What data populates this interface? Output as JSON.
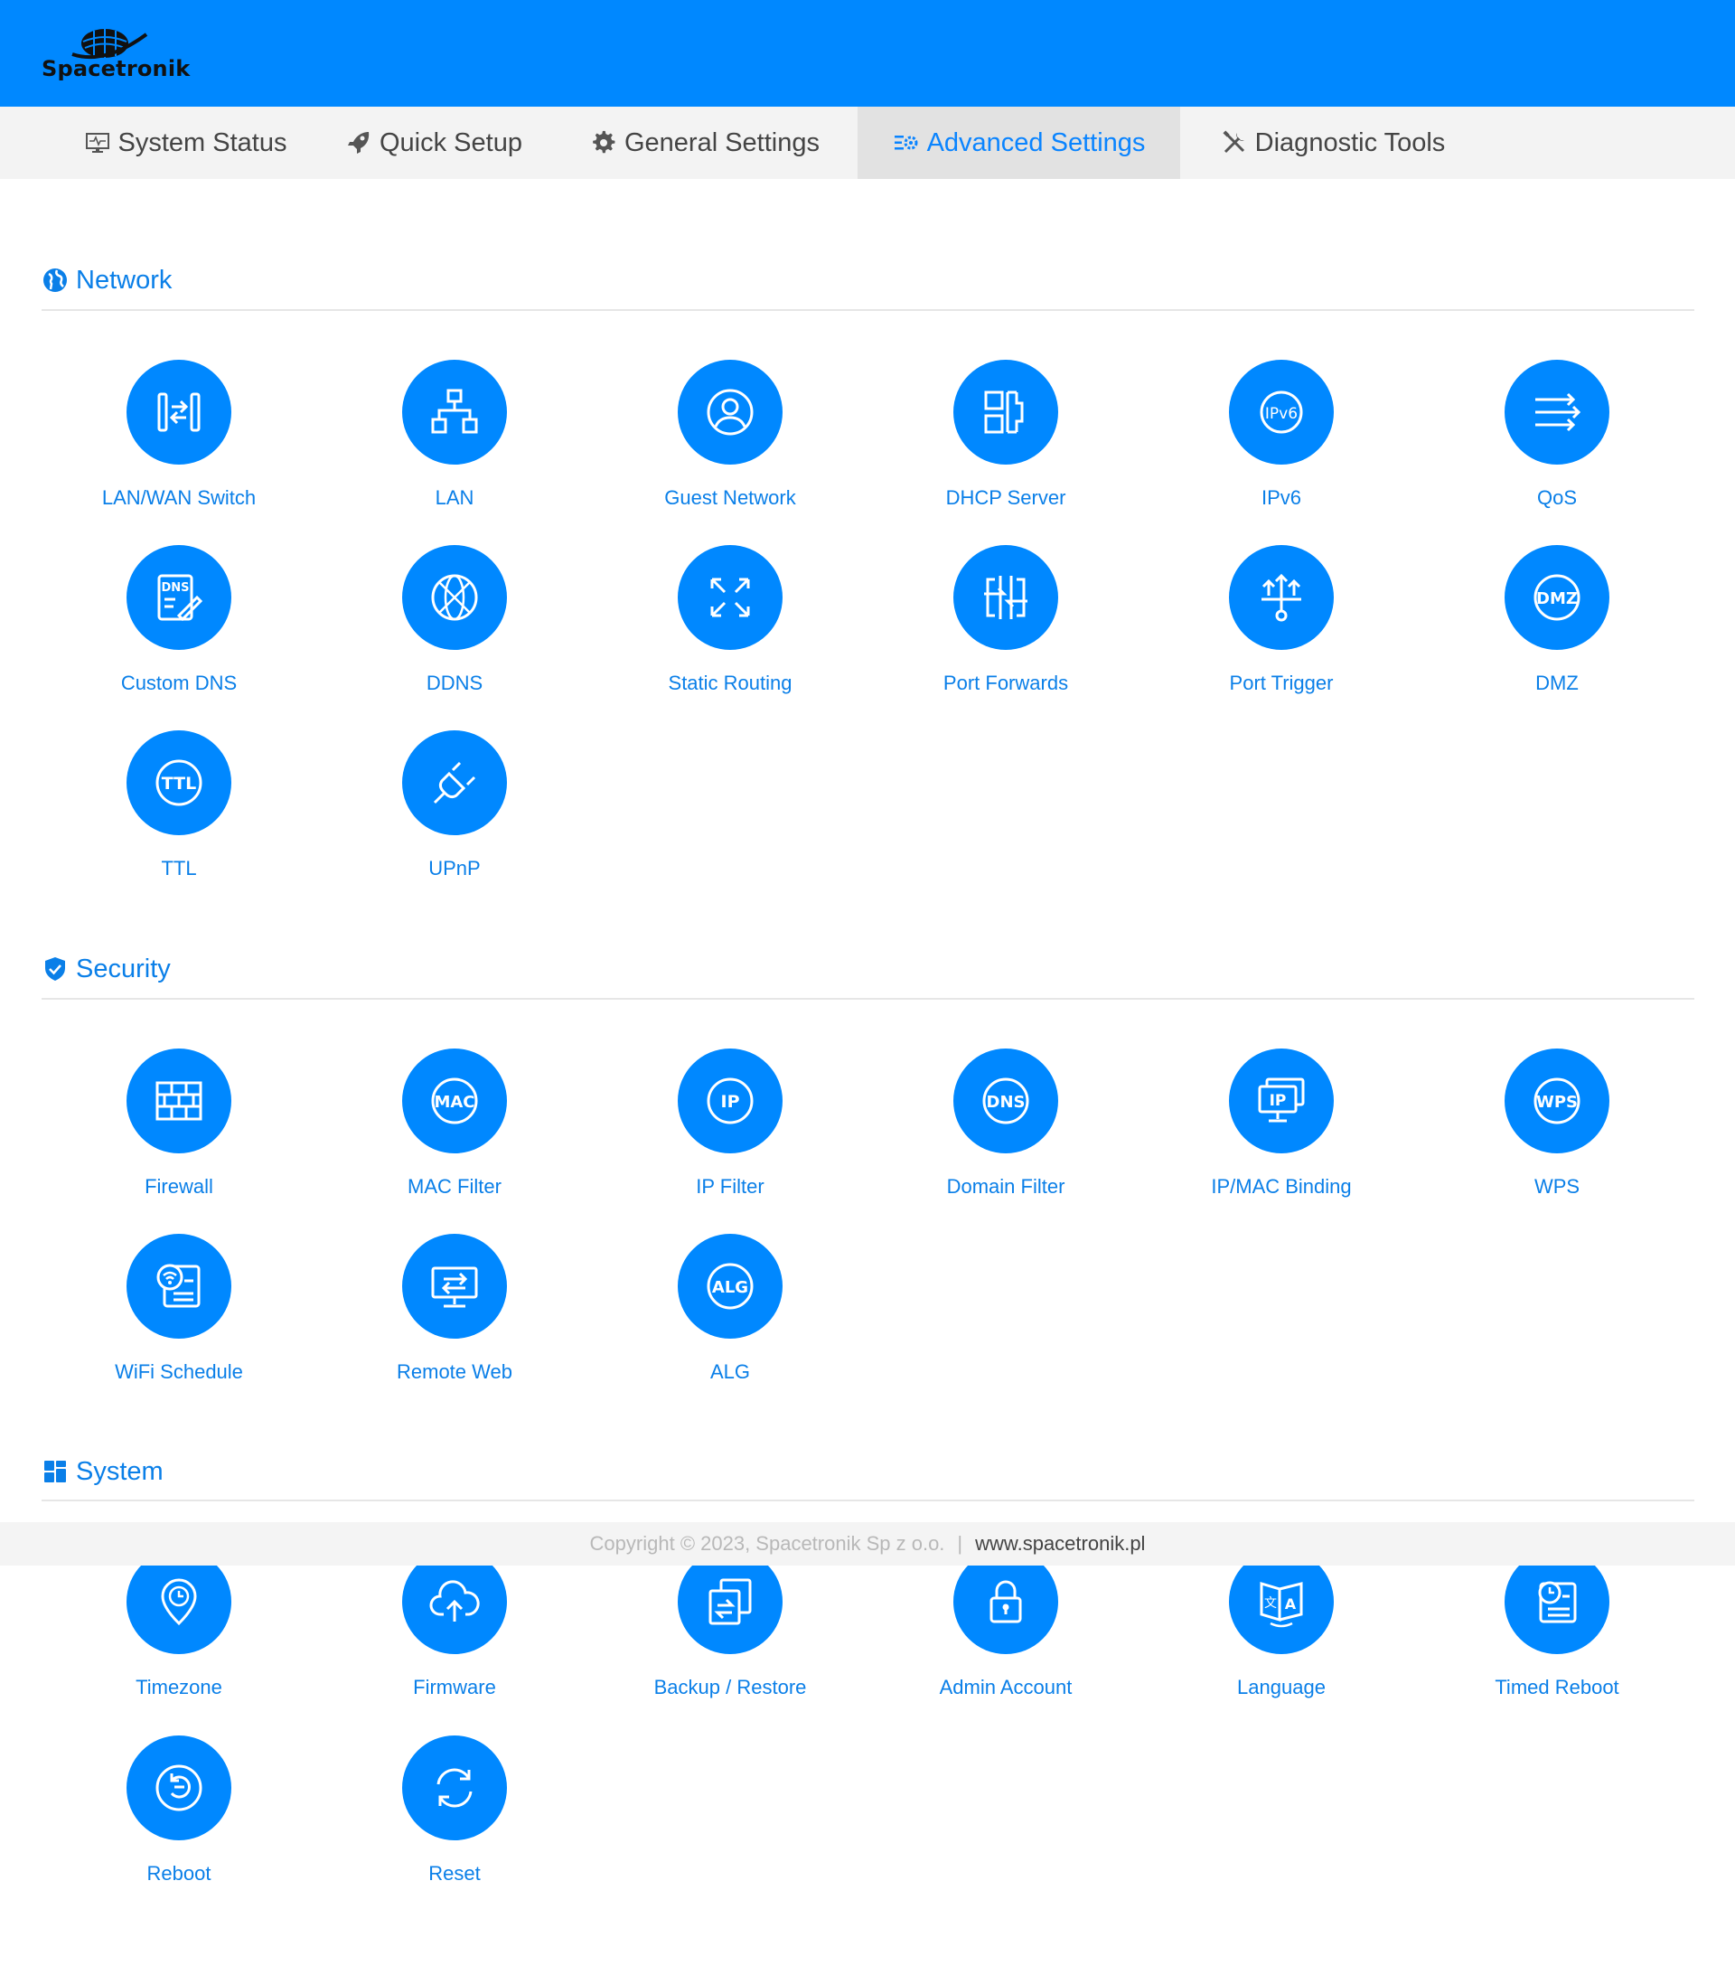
{
  "brand": {
    "name": "Spacetronik",
    "color": "#0088ff"
  },
  "nav": [
    {
      "label": "System Status",
      "icon": "monitor-pulse-icon"
    },
    {
      "label": "Quick Setup",
      "icon": "rocket-icon"
    },
    {
      "label": "General Settings",
      "icon": "gear-icon"
    },
    {
      "label": "Advanced Settings",
      "icon": "sliders-gear-icon",
      "active": true
    },
    {
      "label": "Diagnostic Tools",
      "icon": "tools-icon"
    }
  ],
  "sections": {
    "network": {
      "title": "Network",
      "icon": "globe-icon",
      "items": [
        {
          "label": "LAN/WAN Switch",
          "icon": "lan-wan-switch-icon"
        },
        {
          "label": "LAN",
          "icon": "network-tree-icon"
        },
        {
          "label": "Guest Network",
          "icon": "user-circle-icon"
        },
        {
          "label": "DHCP Server",
          "icon": "dhcp-blocks-icon"
        },
        {
          "label": "IPv6",
          "icon": "ipv6-icon"
        },
        {
          "label": "QoS",
          "icon": "qos-arrows-icon"
        },
        {
          "label": "Custom DNS",
          "icon": "dns-edit-icon"
        },
        {
          "label": "DDNS",
          "icon": "ddns-globe-icon"
        },
        {
          "label": "Static Routing",
          "icon": "expand-arrows-icon"
        },
        {
          "label": "Port Forwards",
          "icon": "port-forward-icon"
        },
        {
          "label": "Port Trigger",
          "icon": "port-trigger-icon"
        },
        {
          "label": "DMZ",
          "icon": "dmz-icon"
        },
        {
          "label": "TTL",
          "icon": "ttl-icon"
        },
        {
          "label": "UPnP",
          "icon": "plug-icon"
        }
      ]
    },
    "security": {
      "title": "Security",
      "icon": "shield-check-icon",
      "items": [
        {
          "label": "Firewall",
          "icon": "firewall-icon"
        },
        {
          "label": "MAC Filter",
          "icon": "mac-icon"
        },
        {
          "label": "IP Filter",
          "icon": "ip-icon"
        },
        {
          "label": "Domain Filter",
          "icon": "dns-icon"
        },
        {
          "label": "IP/MAC Binding",
          "icon": "ip-mac-binding-icon"
        },
        {
          "label": "WPS",
          "icon": "wps-icon"
        },
        {
          "label": "WiFi Schedule",
          "icon": "wifi-schedule-icon"
        },
        {
          "label": "Remote Web",
          "icon": "remote-monitor-icon"
        },
        {
          "label": "ALG",
          "icon": "alg-icon"
        }
      ]
    },
    "system": {
      "title": "System",
      "icon": "dashboard-grid-icon",
      "items": [
        {
          "label": "Timezone",
          "icon": "location-clock-icon"
        },
        {
          "label": "Firmware",
          "icon": "cloud-upload-icon"
        },
        {
          "label": "Backup / Restore",
          "icon": "backup-restore-icon"
        },
        {
          "label": "Admin Account",
          "icon": "lock-icon"
        },
        {
          "label": "Language",
          "icon": "language-book-icon"
        },
        {
          "label": "Timed Reboot",
          "icon": "timed-reboot-icon"
        },
        {
          "label": "Reboot",
          "icon": "reboot-icon"
        },
        {
          "label": "Reset",
          "icon": "reset-icon"
        }
      ]
    }
  },
  "footer": {
    "copyright": "Copyright © 2023, Spacetronik Sp z o.o.",
    "separator": "|",
    "website": "www.spacetronik.pl"
  }
}
